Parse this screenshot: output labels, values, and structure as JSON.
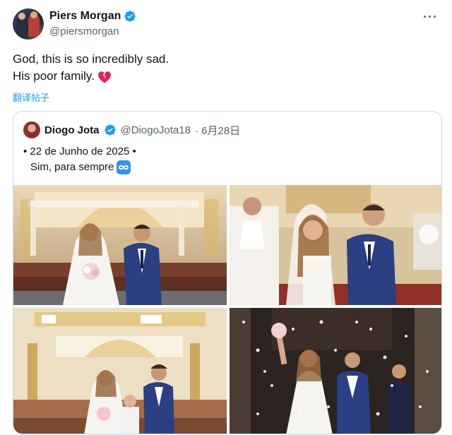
{
  "tweet": {
    "display_name": "Piers Morgan",
    "handle": "@piersmorgan",
    "more_icon": "···",
    "text_line1": "God, this is so incredibly sad.",
    "text_line2": "His poor family.",
    "translate_label": "翻译帖子"
  },
  "quote": {
    "display_name": "Diogo Jota",
    "handle": "@DiogoJota18",
    "date": "· 6月28日",
    "line1": "• 22 de Junho de 2025 •",
    "line2": "Sim, para sempre"
  },
  "colors": {
    "accent": "#1d9bf0",
    "text": "#0f1419",
    "secondary": "#536471",
    "border": "#cfd9de",
    "heart": "#e0245e"
  },
  "icons": [
    "verified-badge-icon",
    "more-icon",
    "broken-heart-icon",
    "infinity-icon"
  ]
}
